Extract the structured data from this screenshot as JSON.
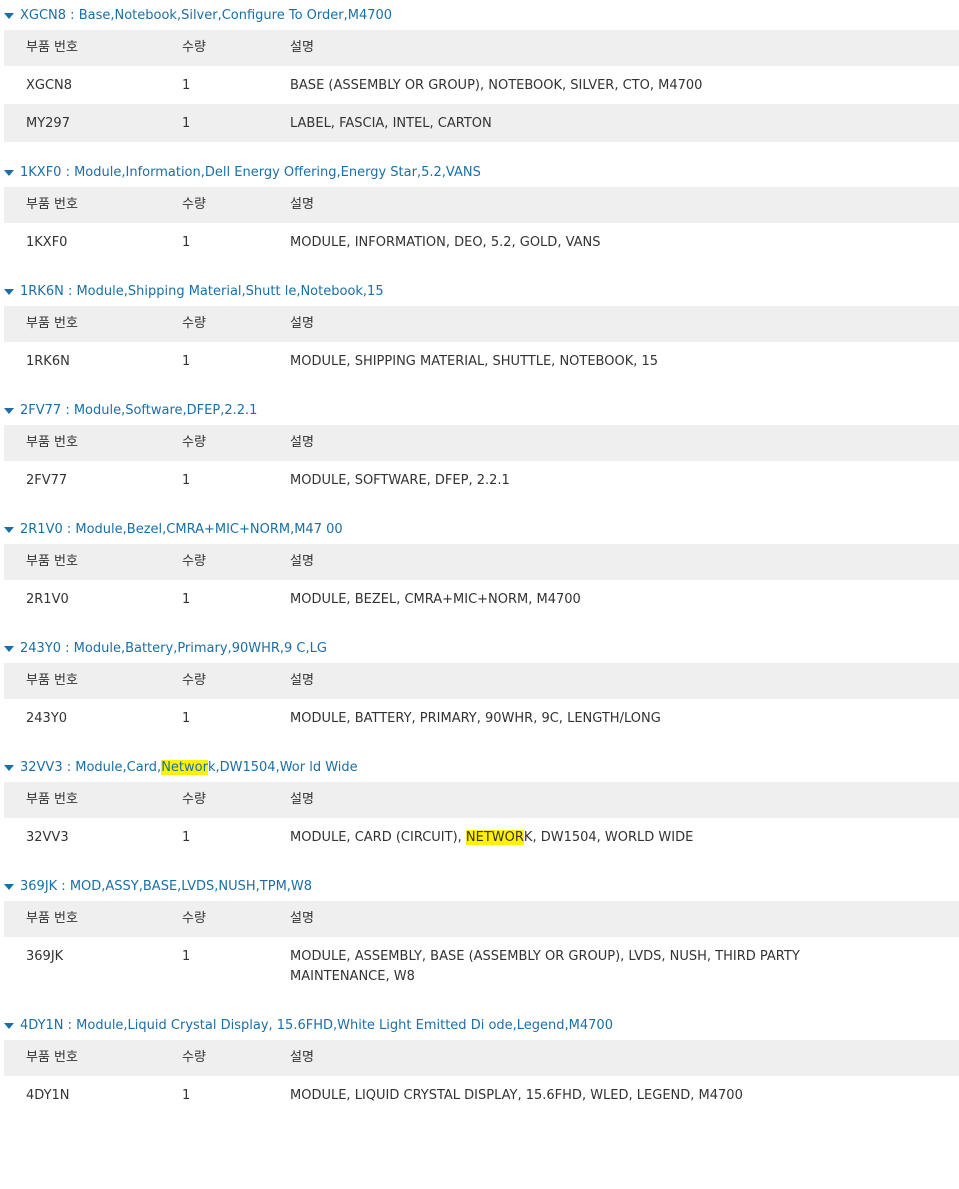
{
  "columns": {
    "part": "부품 번호",
    "qty": "수량",
    "desc": "설명"
  },
  "highlight_color": "#fff200",
  "accent_color": "#1a6fa8",
  "sections": [
    {
      "title": "XGCN8 : Base,Notebook,Silver,Configure To Order,M4700",
      "rows": [
        {
          "part": "XGCN8",
          "qty": "1",
          "desc": "BASE (ASSEMBLY OR GROUP), NOTEBOOK, SILVER, CTO, M4700"
        },
        {
          "part": "MY297",
          "qty": "1",
          "desc": "LABEL, FASCIA, INTEL, CARTON"
        }
      ]
    },
    {
      "title": "1KXF0 : Module,Information,Dell Energy Offering,Energy Star,5.2,VANS",
      "rows": [
        {
          "part": "1KXF0",
          "qty": "1",
          "desc": "MODULE, INFORMATION, DEO, 5.2, GOLD, VANS"
        }
      ]
    },
    {
      "title": "1RK6N : Module,Shipping Material,Shutt le,Notebook,15",
      "rows": [
        {
          "part": "1RK6N",
          "qty": "1",
          "desc": "MODULE, SHIPPING MATERIAL, SHUTTLE, NOTEBOOK, 15"
        }
      ]
    },
    {
      "title": "2FV77 : Module,Software,DFEP,2.2.1",
      "rows": [
        {
          "part": "2FV77",
          "qty": "1",
          "desc": "MODULE, SOFTWARE, DFEP, 2.2.1"
        }
      ]
    },
    {
      "title": "2R1V0 : Module,Bezel,CMRA+MIC+NORM,M47 00",
      "rows": [
        {
          "part": "2R1V0",
          "qty": "1",
          "desc": "MODULE, BEZEL, CMRA+MIC+NORM, M4700"
        }
      ]
    },
    {
      "title": "243Y0 : Module,Battery,Primary,90WHR,9 C,LG",
      "rows": [
        {
          "part": "243Y0",
          "qty": "1",
          "desc": "MODULE, BATTERY, PRIMARY, 90WHR, 9C, LENGTH/LONG"
        }
      ]
    },
    {
      "title_pre": "32VV3 : Module,Card,",
      "title_hl": "Networ",
      "title_post": "k,DW1504,Wor ld Wide",
      "rows": [
        {
          "part": "32VV3",
          "qty": "1",
          "desc_pre": "MODULE, CARD (CIRCUIT), ",
          "desc_hl": "NETWOR",
          "desc_post": "K, DW1504, WORLD WIDE"
        }
      ]
    },
    {
      "title": "369JK : MOD,ASSY,BASE,LVDS,NUSH,TPM,W8",
      "rows": [
        {
          "part": "369JK",
          "qty": "1",
          "desc": "MODULE, ASSEMBLY, BASE (ASSEMBLY OR GROUP), LVDS, NUSH, THIRD PARTY MAINTENANCE, W8"
        }
      ]
    },
    {
      "title": "4DY1N : Module,Liquid Crystal Display, 15.6FHD,White Light Emitted Di ode,Legend,M4700",
      "rows": [
        {
          "part": "4DY1N",
          "qty": "1",
          "desc": "MODULE, LIQUID CRYSTAL DISPLAY, 15.6FHD, WLED, LEGEND, M4700"
        }
      ]
    }
  ]
}
